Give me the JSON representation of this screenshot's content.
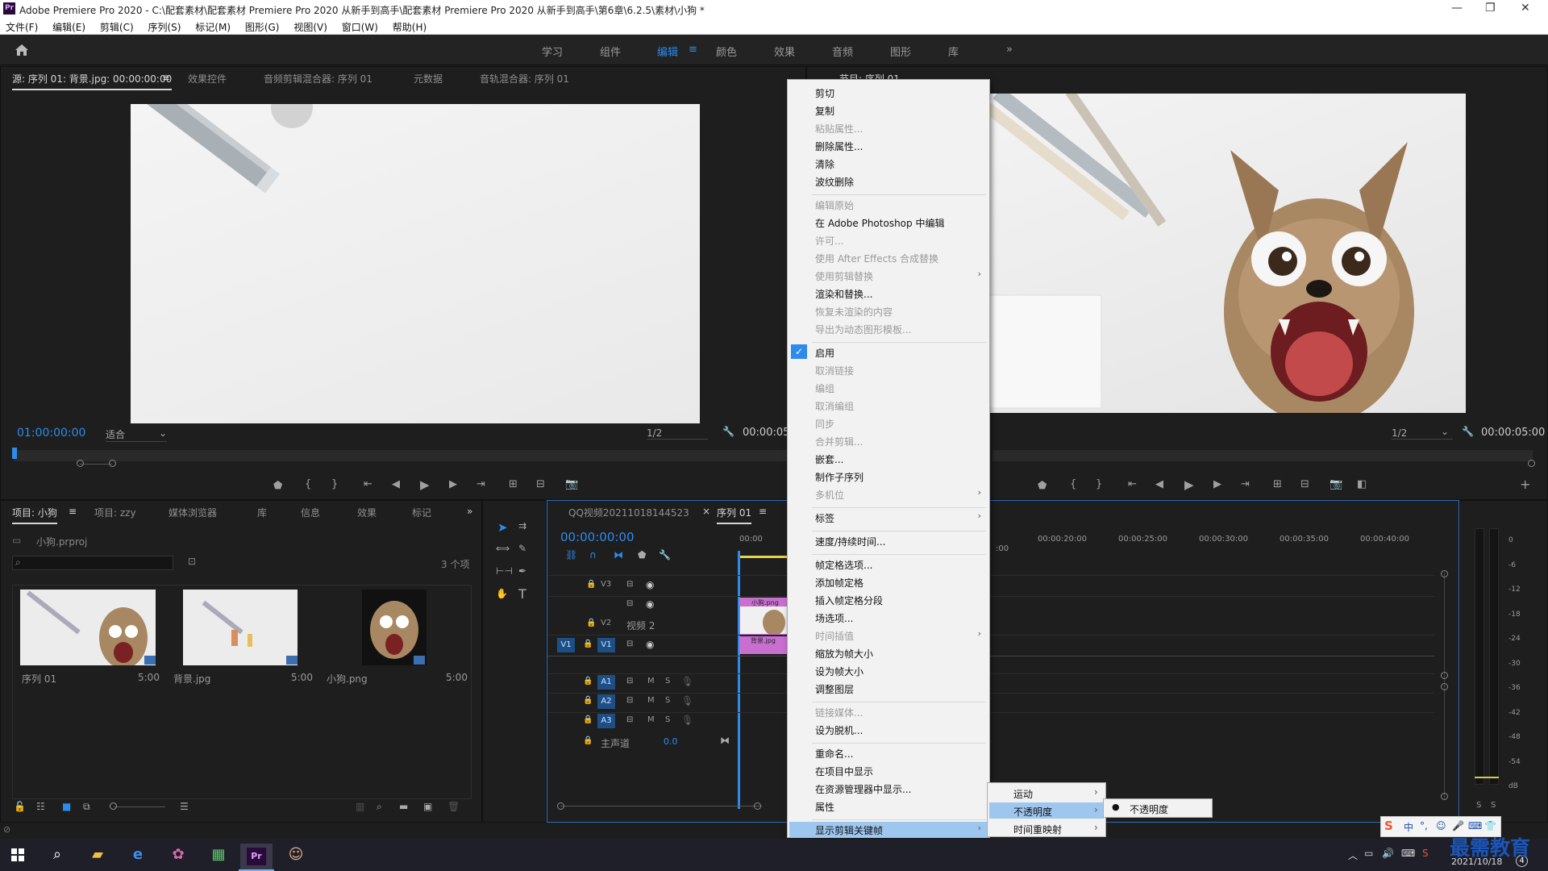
{
  "titlebar": {
    "logo": "Pr",
    "title": "Adobe Premiere Pro 2020 - C:\\配套素材\\配套素材 Premiere Pro 2020 从新手到高手\\配套素材 Premiere Pro 2020 从新手到高手\\第6章\\6.2.5\\素材\\小狗 *",
    "min": "—",
    "max": "❐",
    "close": "✕"
  },
  "menubar": [
    "文件(F)",
    "编辑(E)",
    "剪辑(C)",
    "序列(S)",
    "标记(M)",
    "图形(G)",
    "视图(V)",
    "窗口(W)",
    "帮助(H)"
  ],
  "workspaces": [
    "学习",
    "组件",
    "编辑",
    "颜色",
    "效果",
    "音频",
    "图形",
    "库"
  ],
  "workspace_more": "»",
  "source_panel": {
    "tabs": [
      "源: 序列 01: 背景.jpg: 00:00:00:00",
      "效果控件",
      "音频剪辑混合器: 序列 01",
      "元数据",
      "音轨混合器: 序列 01"
    ],
    "timecode": "01:00:00:00",
    "fit": "适合",
    "res": "1/2",
    "duration": "00:00:05"
  },
  "program_panel": {
    "tab": "节目: 序列 01",
    "res": "1/2",
    "duration": "00:00:05:00"
  },
  "project_panel": {
    "tabs": [
      "项目: 小狗",
      "项目: zzy",
      "媒体浏览器",
      "库",
      "信息",
      "效果",
      "标记"
    ],
    "more": "»",
    "file": "小狗.prproj",
    "count": "3 个项",
    "items": [
      {
        "name": "序列 01",
        "dur": "5:00"
      },
      {
        "name": "背景.jpg",
        "dur": "5:00"
      },
      {
        "name": "小狗.png",
        "dur": "5:00"
      }
    ]
  },
  "timeline": {
    "tabs": [
      "QQ视频20211018144523",
      "序列 01"
    ],
    "close": "×",
    "timecode": "00:00:00:00",
    "ruler": [
      "00:00",
      "00:00:20:00",
      "00:00:25:00",
      "00:00:30:00",
      "00:00:35:00",
      "00:00:40:00"
    ],
    "ruler_cont": ":00",
    "tracks": [
      {
        "id": "V3",
        "name": ""
      },
      {
        "id": "V2",
        "name": "视频 2"
      },
      {
        "id": "V1",
        "name": ""
      },
      {
        "id": "A1",
        "name": ""
      },
      {
        "id": "A2",
        "name": ""
      },
      {
        "id": "A3",
        "name": ""
      }
    ],
    "master": "主声道",
    "master_val": "0.0",
    "clip_v2": "小狗.png",
    "clip_v1": "背景.jpg",
    "src_patch": "V1",
    "m": "M",
    "s": "S"
  },
  "meter": {
    "labels": [
      "0",
      "-6",
      "-12",
      "-18",
      "-24",
      "-30",
      "-36",
      "-42",
      "-48",
      "-54",
      "dB"
    ],
    "solo": [
      "S",
      "S"
    ]
  },
  "context_menu": {
    "items": [
      {
        "label": "剪切",
        "enabled": true
      },
      {
        "label": "复制",
        "enabled": true
      },
      {
        "label": "粘贴属性...",
        "enabled": false
      },
      {
        "label": "删除属性...",
        "enabled": true
      },
      {
        "label": "清除",
        "enabled": true
      },
      {
        "label": "波纹删除",
        "enabled": true
      },
      {
        "label": "编辑原始",
        "enabled": false
      },
      {
        "label": "在 Adobe Photoshop 中编辑",
        "enabled": true
      },
      {
        "label": "许可...",
        "enabled": false
      },
      {
        "label": "使用 After Effects 合成替换",
        "enabled": false
      },
      {
        "label": "使用剪辑替换",
        "enabled": false,
        "sub": true
      },
      {
        "label": "渲染和替换...",
        "enabled": true
      },
      {
        "label": "恢复未渲染的内容",
        "enabled": false
      },
      {
        "label": "导出为动态图形模板...",
        "enabled": false
      },
      {
        "label": "启用",
        "enabled": true,
        "checked": true
      },
      {
        "label": "取消链接",
        "enabled": false
      },
      {
        "label": "编组",
        "enabled": false
      },
      {
        "label": "取消编组",
        "enabled": false
      },
      {
        "label": "同步",
        "enabled": false
      },
      {
        "label": "合并剪辑...",
        "enabled": false
      },
      {
        "label": "嵌套...",
        "enabled": true
      },
      {
        "label": "制作子序列",
        "enabled": true
      },
      {
        "label": "多机位",
        "enabled": false,
        "sub": true
      },
      {
        "label": "标签",
        "enabled": true,
        "sub": true
      },
      {
        "label": "速度/持续时间...",
        "enabled": true
      },
      {
        "label": "帧定格选项...",
        "enabled": true
      },
      {
        "label": "添加帧定格",
        "enabled": true
      },
      {
        "label": "插入帧定格分段",
        "enabled": true
      },
      {
        "label": "场选项...",
        "enabled": true
      },
      {
        "label": "时间插值",
        "enabled": false,
        "sub": true
      },
      {
        "label": "缩放为帧大小",
        "enabled": true
      },
      {
        "label": "设为帧大小",
        "enabled": true
      },
      {
        "label": "调整图层",
        "enabled": true
      },
      {
        "label": "链接媒体...",
        "enabled": false
      },
      {
        "label": "设为脱机...",
        "enabled": true
      },
      {
        "label": "重命名...",
        "enabled": true
      },
      {
        "label": "在项目中显示",
        "enabled": true
      },
      {
        "label": "在资源管理器中显示...",
        "enabled": true
      },
      {
        "label": "属性",
        "enabled": true
      },
      {
        "label": "显示剪辑关键帧",
        "enabled": true,
        "sub": true,
        "highlighted": true
      }
    ],
    "submenu": [
      {
        "label": "运动",
        "hl": false
      },
      {
        "label": "不透明度",
        "hl": true
      },
      {
        "label": "时间重映射",
        "hl": false
      }
    ],
    "submenu2": "不透明度"
  },
  "taskbar": {
    "time": "2021/10/18",
    "ime": "中",
    "badge": "4"
  },
  "watermark": "最需教育",
  "colors": {
    "accent": "#2d8ceb",
    "menu_hl": "#9ec7f0",
    "clip_v2": "#c86fd0",
    "clip_v1": "#c86fd0"
  }
}
